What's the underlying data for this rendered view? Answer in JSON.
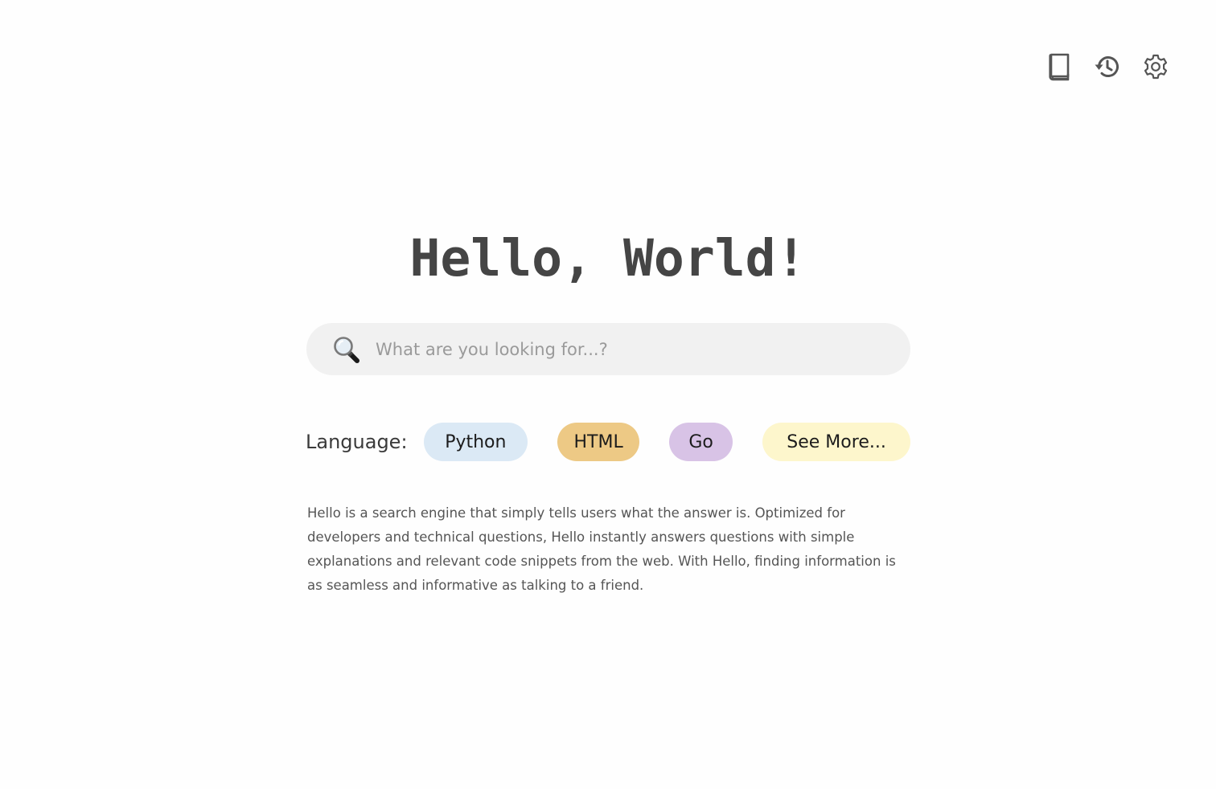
{
  "toolbar": {
    "icons": [
      {
        "name": "book-icon",
        "color": "#555555"
      },
      {
        "name": "history-icon",
        "color": "#555555"
      },
      {
        "name": "settings-icon",
        "color": "#555555"
      }
    ]
  },
  "hero": {
    "title": "Hello, World!"
  },
  "search": {
    "icon": "magnifying-glass-icon",
    "placeholder": "What are you looking for...?",
    "value": ""
  },
  "languages": {
    "label": "Language:",
    "chips": [
      {
        "label": "Python",
        "color": "#dbe9f5"
      },
      {
        "label": "HTML",
        "color": "#edc985"
      },
      {
        "label": "Go",
        "color": "#d8c3e6"
      },
      {
        "label": "See More...",
        "color": "#fdf6cc"
      }
    ]
  },
  "description": "Hello is a search engine that simply tells users what the answer is. Optimized for developers and technical questions, Hello instantly answers questions with simple explanations and relevant code snippets from the web. With Hello, finding information is as seamless and informative as talking to a friend."
}
